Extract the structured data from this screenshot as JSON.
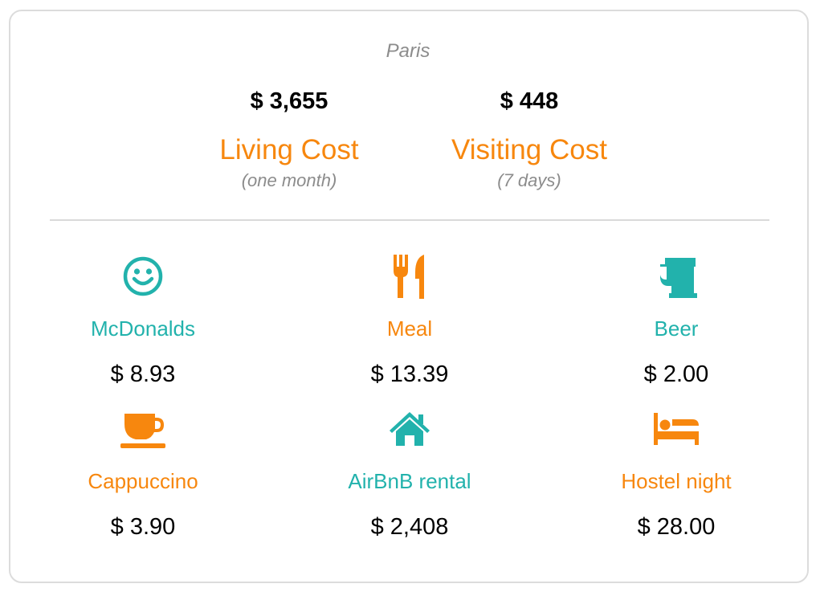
{
  "city": "Paris",
  "summary": {
    "living": {
      "amount": "$ 3,655",
      "label": "Living Cost",
      "period": "(one month)"
    },
    "visiting": {
      "amount": "$ 448",
      "label": "Visiting Cost",
      "period": "(7 days)"
    }
  },
  "colors": {
    "orange": "#f7870e",
    "teal": "#22b2ac"
  },
  "items": [
    {
      "name": "McDonalds",
      "price": "$ 8.93",
      "icon": "smiley-icon",
      "color": "teal"
    },
    {
      "name": "Meal",
      "price": "$ 13.39",
      "icon": "fork-knife-icon",
      "color": "orange"
    },
    {
      "name": "Beer",
      "price": "$ 2.00",
      "icon": "beer-mug-icon",
      "color": "teal"
    },
    {
      "name": "Cappuccino",
      "price": "$ 3.90",
      "icon": "coffee-cup-icon",
      "color": "orange"
    },
    {
      "name": "AirBnB rental",
      "price": "$ 2,408",
      "icon": "house-icon",
      "color": "teal"
    },
    {
      "name": "Hostel night",
      "price": "$ 28.00",
      "icon": "bed-icon",
      "color": "orange"
    }
  ]
}
